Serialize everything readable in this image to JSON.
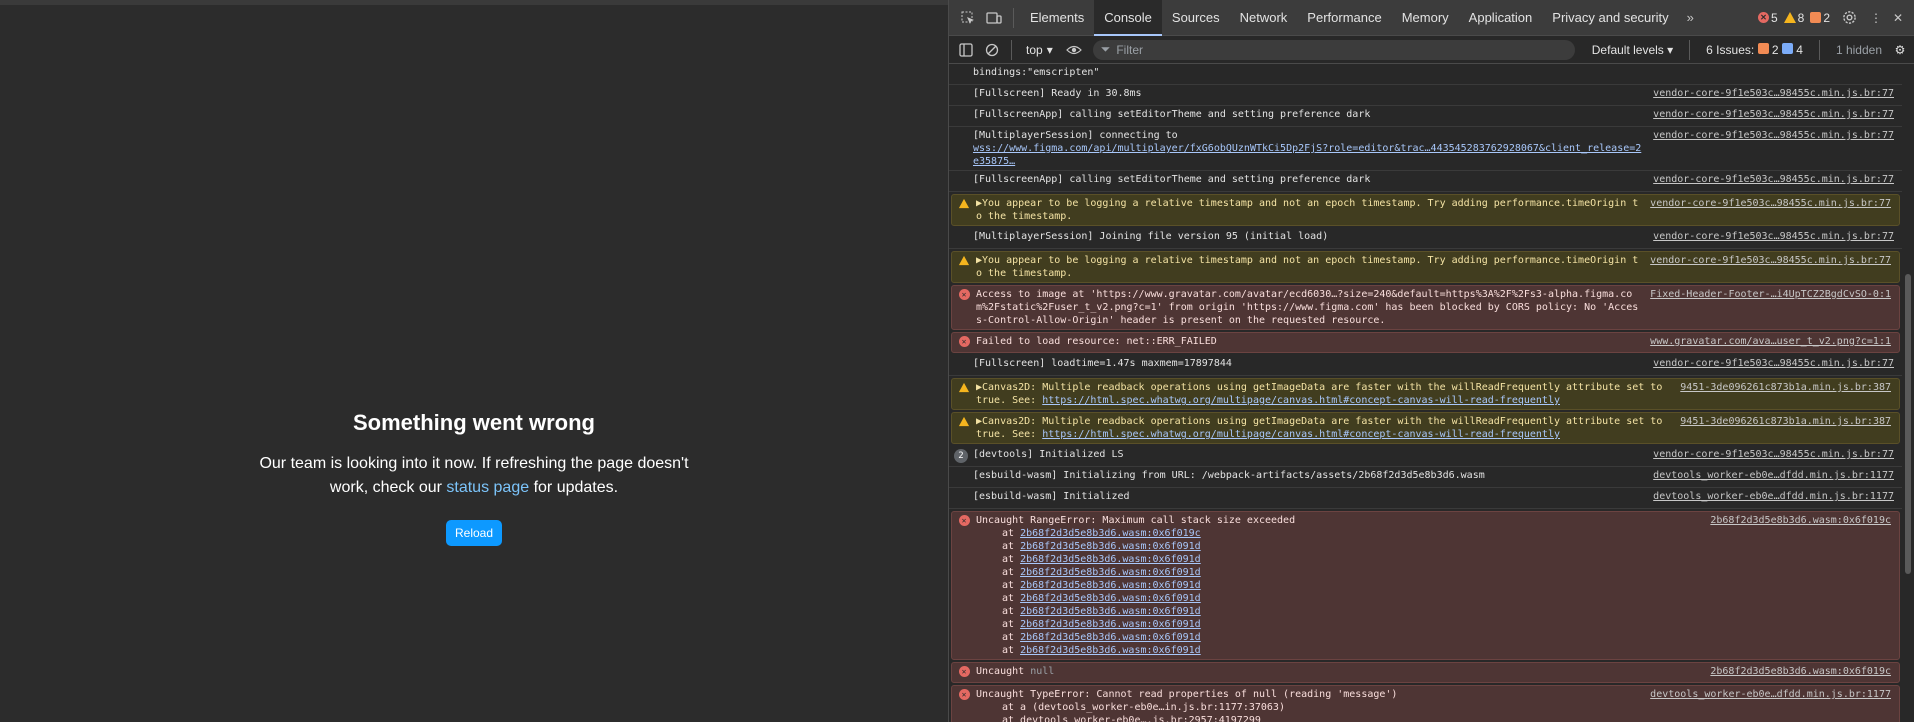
{
  "app": {
    "title": "Something went wrong",
    "message_before": "Our team is looking into it now. If refreshing the page doesn't work, check our ",
    "link": "status page",
    "message_after": " for updates.",
    "reload": "Reload"
  },
  "devtools": {
    "tabs": [
      "Elements",
      "Console",
      "Sources",
      "Network",
      "Performance",
      "Memory",
      "Application",
      "Privacy and security"
    ],
    "more": "»",
    "counts": {
      "errors": "5",
      "warnings": "8",
      "issues": "2"
    },
    "context": "top",
    "filter_placeholder": "Filter",
    "levels": "Default levels",
    "issues_label": "6 Issues:",
    "issues_err": "2",
    "issues_info": "4",
    "hidden": "1 hidden"
  },
  "console": [
    {
      "type": "log",
      "text": "bindings:\"emscripten\"",
      "src": ""
    },
    {
      "type": "log",
      "text": "[Fullscreen] Ready in 30.8ms",
      "src": "vendor-core-9f1e503c…98455c.min.js.br:77"
    },
    {
      "type": "log",
      "text": "[FullscreenApp] calling setEditorTheme and setting preference dark",
      "src": "vendor-core-9f1e503c…98455c.min.js.br:77"
    },
    {
      "type": "log",
      "text": "[MultiplayerSession] connecting to",
      "link": "wss://www.figma.com/api/multiplayer/fxG6obQUznWTkCi5Dp2FjS?role=editor&trac…443545283762928067&client_release=2e35875…",
      "src": "vendor-core-9f1e503c…98455c.min.js.br:77"
    },
    {
      "type": "log",
      "text": "[FullscreenApp] calling setEditorTheme and setting preference dark",
      "src": "vendor-core-9f1e503c…98455c.min.js.br:77"
    },
    {
      "type": "warn",
      "text": "▶You appear to be logging a relative timestamp and not an epoch timestamp. Try adding performance.timeOrigin to the timestamp.",
      "src": "vendor-core-9f1e503c…98455c.min.js.br:77"
    },
    {
      "type": "log",
      "text": "[MultiplayerSession] Joining file version 95 (initial load)",
      "src": "vendor-core-9f1e503c…98455c.min.js.br:77"
    },
    {
      "type": "warn",
      "text": "▶You appear to be logging a relative timestamp and not an epoch timestamp. Try adding performance.timeOrigin to the timestamp.",
      "src": "vendor-core-9f1e503c…98455c.min.js.br:77"
    },
    {
      "type": "error",
      "text": "Access to image at 'https://www.gravatar.com/avatar/ecd6030…?size=240&default=https%3A%2F%2Fs3-alpha.figma.com%2Fstatic%2Fuser_t_v2.png?c=1' from origin 'https://www.figma.com' has been blocked by CORS policy: No 'Access-Control-Allow-Origin' header is present on the requested resource.",
      "src": "Fixed-Header-Footer-…i4UpTCZ2BgdCvSO-0:1"
    },
    {
      "type": "error",
      "text": "Failed to load resource: net::ERR_FAILED",
      "src": "www.gravatar.com/ava…user_t_v2.png?c=1:1"
    },
    {
      "type": "log",
      "text": "[Fullscreen] loadtime=1.47s maxmem=17897844",
      "src": "vendor-core-9f1e503c…98455c.min.js.br:77"
    },
    {
      "type": "warn",
      "text": "▶Canvas2D: Multiple readback operations using getImageData are faster with the willReadFrequently attribute set to true. See: ",
      "link": "https://html.spec.whatwg.org/multipage/canvas.html#concept-canvas-will-read-frequently",
      "src": "9451-3de096261c873b1a.min.js.br:387"
    },
    {
      "type": "warn",
      "text": "▶Canvas2D: Multiple readback operations using getImageData are faster with the willReadFrequently attribute set to true. See: ",
      "link": "https://html.spec.whatwg.org/multipage/canvas.html#concept-canvas-will-read-frequently",
      "src": "9451-3de096261c873b1a.min.js.br:387"
    },
    {
      "type": "log",
      "badge": "2",
      "text": "[devtools] Initialized LS",
      "src": "vendor-core-9f1e503c…98455c.min.js.br:77"
    },
    {
      "type": "log",
      "text": "[esbuild-wasm] Initializing from URL: /webpack-artifacts/assets/2b68f2d3d5e8b3d6.wasm",
      "src": "devtools_worker-eb0e…dfdd.min.js.br:1177"
    },
    {
      "type": "log",
      "text": "[esbuild-wasm] Initialized",
      "src": "devtools_worker-eb0e…dfdd.min.js.br:1177"
    },
    {
      "type": "error",
      "text": "Uncaught RangeError: Maximum call stack size exceeded",
      "stack": [
        "2b68f2d3d5e8b3d6.wasm:0x6f019c",
        "2b68f2d3d5e8b3d6.wasm:0x6f091d",
        "2b68f2d3d5e8b3d6.wasm:0x6f091d",
        "2b68f2d3d5e8b3d6.wasm:0x6f091d",
        "2b68f2d3d5e8b3d6.wasm:0x6f091d",
        "2b68f2d3d5e8b3d6.wasm:0x6f091d",
        "2b68f2d3d5e8b3d6.wasm:0x6f091d",
        "2b68f2d3d5e8b3d6.wasm:0x6f091d",
        "2b68f2d3d5e8b3d6.wasm:0x6f091d",
        "2b68f2d3d5e8b3d6.wasm:0x6f091d"
      ],
      "src": "2b68f2d3d5e8b3d6.wasm:0x6f019c"
    },
    {
      "type": "error",
      "text": "Uncaught ",
      "null": "null",
      "src": "2b68f2d3d5e8b3d6.wasm:0x6f019c"
    },
    {
      "type": "error",
      "text": "Uncaught TypeError: Cannot read properties of null (reading 'message')",
      "stack2": [
        "at a (devtools_worker-eb0e…in.js.br:1177:37063)",
        "at devtools_worker-eb0e….js.br:2957:4197299"
      ],
      "src": "devtools_worker-eb0e…dfdd.min.js.br:1177"
    }
  ],
  "prompt": "›"
}
